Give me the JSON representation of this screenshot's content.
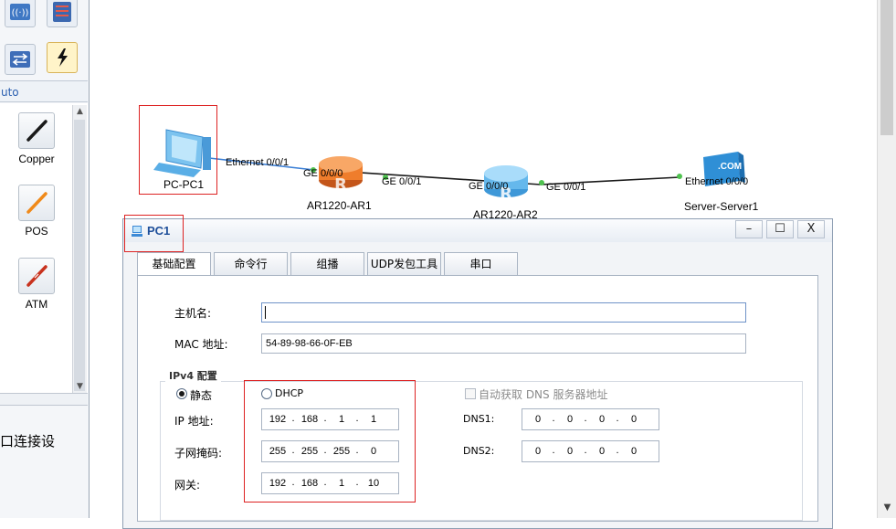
{
  "palette": {
    "auto_label": "uto",
    "cables": [
      {
        "label": "Copper",
        "color": "#1a1a1a"
      },
      {
        "label": "POS",
        "color": "#f08a1a"
      },
      {
        "label": "ATM",
        "color": "#c8321e"
      }
    ],
    "info_text": "口连接设"
  },
  "topology": {
    "devices": [
      {
        "name": "PC-PC1"
      },
      {
        "name": "AR1220-AR1"
      },
      {
        "name": "AR1220-AR2"
      },
      {
        "name": "Server-Server1"
      }
    ],
    "ports": {
      "pc1_eth": "Ethernet 0/0/1",
      "ar1_ge000": "GE 0/0/0",
      "ar1_ge001": "GE 0/0/1",
      "ar2_ge000": "GE 0/0/0",
      "ar2_ge001": "GE 0/0/1",
      "server_eth": "Ethernet 0/0/0"
    },
    "server_badge": ".COM",
    "link_color_pc": "#3b7fd6",
    "link_color_wan": "#1a1a1a",
    "port_dot_color": "#4fc24f"
  },
  "dialog": {
    "title": "PC1",
    "buttons": {
      "minimize": "–",
      "maximize": "☐",
      "close": "X"
    },
    "tabs": [
      {
        "label": "基础配置",
        "active": true
      },
      {
        "label": "命令行",
        "active": false
      },
      {
        "label": "组播",
        "active": false
      },
      {
        "label": "UDP发包工具",
        "active": false
      },
      {
        "label": "串口",
        "active": false
      }
    ],
    "hostname_label": "主机名:",
    "hostname_value": "",
    "mac_label": "MAC 地址:",
    "mac_value": "54-89-98-66-0F-EB",
    "ipv4_legend": "IPv4 配置",
    "static_label": "静态",
    "dhcp_label": "DHCP",
    "auto_dns_label": "自动获取 DNS 服务器地址",
    "ip_label": "IP 地址:",
    "mask_label": "子网掩码:",
    "gateway_label": "网关:",
    "dns1_label": "DNS1:",
    "dns2_label": "DNS2:",
    "ip": [
      "192",
      "168",
      "1",
      "1"
    ],
    "mask": [
      "255",
      "255",
      "255",
      "0"
    ],
    "gateway": [
      "192",
      "168",
      "1",
      "10"
    ],
    "dns1": [
      "0",
      "0",
      "0",
      "0"
    ],
    "dns2": [
      "0",
      "0",
      "0",
      "0"
    ]
  }
}
